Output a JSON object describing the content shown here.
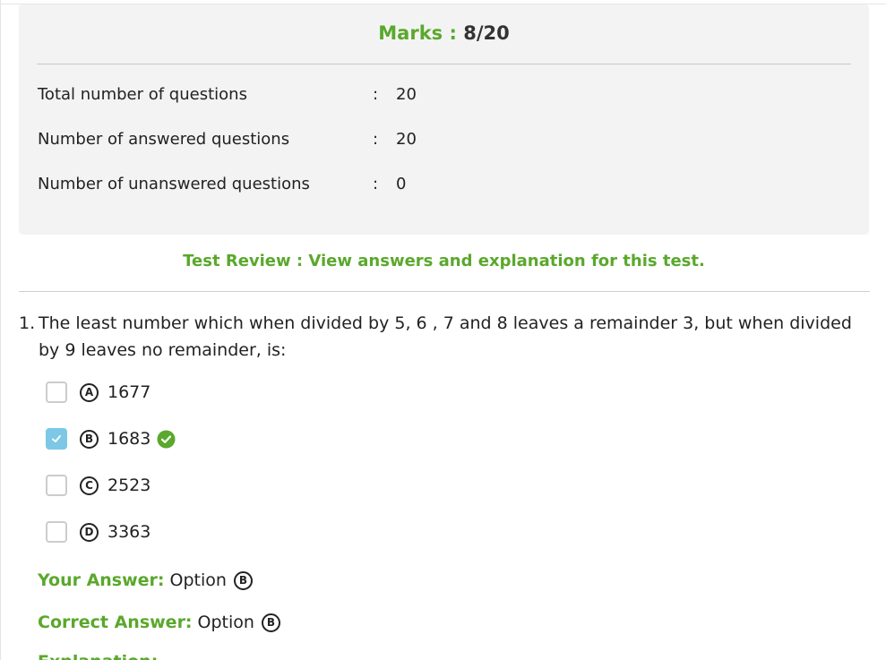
{
  "summary": {
    "marks_label": "Marks :",
    "marks_value": "8/20",
    "stats": [
      {
        "label": "Total number of questions",
        "colon": ":",
        "value": "20"
      },
      {
        "label": "Number of answered questions",
        "colon": ":",
        "value": "20"
      },
      {
        "label": "Number of unanswered questions",
        "colon": ":",
        "value": "0"
      }
    ]
  },
  "review": {
    "text": "Test Review : View answers and explanation for this test."
  },
  "question": {
    "number": "1.",
    "text": "The least number which when divided by 5, 6 , 7 and 8 leaves a remainder 3, but when divided by 9 leaves no remainder, is:",
    "options": [
      {
        "letter": "A",
        "value": "1677",
        "checked": false,
        "correct": false
      },
      {
        "letter": "B",
        "value": "1683",
        "checked": true,
        "correct": true
      },
      {
        "letter": "C",
        "value": "2523",
        "checked": false,
        "correct": false
      },
      {
        "letter": "D",
        "value": "3363",
        "checked": false,
        "correct": false
      }
    ],
    "your_answer_label": "Your Answer:",
    "your_answer_value": "Option",
    "your_answer_letter": "B",
    "correct_answer_label": "Correct Answer:",
    "correct_answer_value": "Option",
    "correct_answer_letter": "B",
    "explanation_label": "Explanation:"
  },
  "colors": {
    "accent_green": "#5aa82c",
    "checkbox_checked": "#7cc8e6",
    "summary_bg": "#f3f3f3"
  }
}
